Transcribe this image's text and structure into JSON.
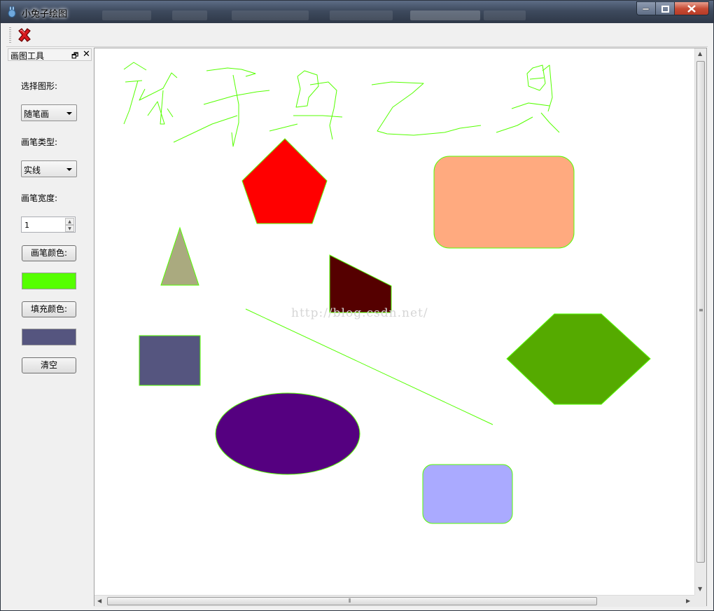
{
  "window": {
    "title": "小兔子绘图"
  },
  "toolbar": {
    "exit_icon": "red-x-icon"
  },
  "dock": {
    "title": "画图工具",
    "shape_label": "选择图形:",
    "shape_value": "随笔画",
    "pen_style_label": "画笔类型:",
    "pen_style_value": "实线",
    "pen_width_label": "画笔宽度:",
    "pen_width_value": "1",
    "pen_color_button": "画笔颜色:",
    "fill_color_button": "填充颜色:",
    "clear_button": "清空"
  },
  "colors": {
    "pen_color": "#55ff00",
    "fill_color": "#55557f",
    "titlebar": "#3e4a5e",
    "close_button": "#c74b34"
  },
  "canvas": {
    "watermark": "http://blog.csdn.net/",
    "shapes": [
      {
        "kind": "freehand",
        "stroke": "#55ff00"
      },
      {
        "kind": "pentagon",
        "fill": "#ff0000",
        "stroke": "#55ff00"
      },
      {
        "kind": "rounded-rect",
        "fill": "#ffaa7f",
        "stroke": "#55ff00"
      },
      {
        "kind": "triangle",
        "fill": "#aaaa7f",
        "stroke": "#55ff00"
      },
      {
        "kind": "trapezoid",
        "fill": "#550000",
        "stroke": "#55ff00"
      },
      {
        "kind": "line",
        "stroke": "#55ff00"
      },
      {
        "kind": "hexagon",
        "fill": "#55aa00",
        "stroke": "#55ff00"
      },
      {
        "kind": "rect",
        "fill": "#55557f",
        "stroke": "#55ff00"
      },
      {
        "kind": "ellipse",
        "fill": "#550080",
        "stroke": "#55ff00"
      },
      {
        "kind": "rounded-rect",
        "fill": "#aaaaff",
        "stroke": "#55ff00"
      }
    ]
  }
}
